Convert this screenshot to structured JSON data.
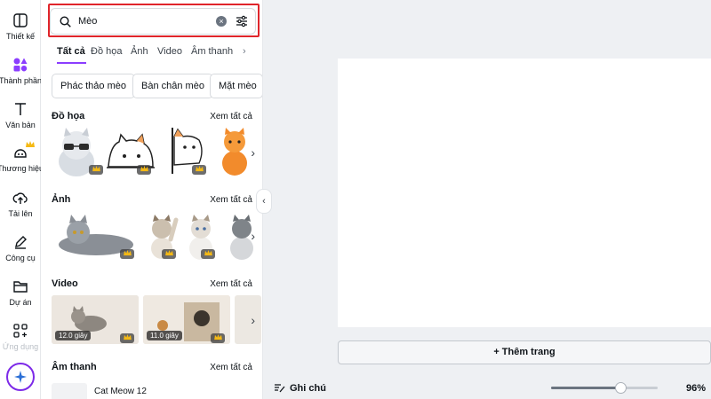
{
  "rail": [
    {
      "label": "Thiết kế",
      "icon": "layout-icon"
    },
    {
      "label": "Thành phần",
      "icon": "elements-icon",
      "active": true
    },
    {
      "label": "Văn bản",
      "icon": "text-icon"
    },
    {
      "label": "Thương hiệu",
      "icon": "brand-icon",
      "premium": true
    },
    {
      "label": "Tải lên",
      "icon": "upload-cloud-icon"
    },
    {
      "label": "Công cụ",
      "icon": "pen-icon"
    },
    {
      "label": "Dự án",
      "icon": "folder-icon"
    },
    {
      "label": "Ứng dụng",
      "icon": "apps-grid-icon"
    }
  ],
  "search": {
    "value": "Mèo"
  },
  "tabs": [
    "Tất cả",
    "Đồ họa",
    "Ảnh",
    "Video",
    "Âm thanh"
  ],
  "chips": [
    "Phác thảo mèo",
    "Bàn chân mèo",
    "Mặt mèo"
  ],
  "sections": {
    "graphics": {
      "title": "Đồ họa",
      "see_all": "Xem tất cả"
    },
    "photos": {
      "title": "Ảnh",
      "see_all": "Xem tất cả"
    },
    "videos": {
      "title": "Video",
      "see_all": "Xem tất cả",
      "durations": [
        "12.0 giây",
        "11.0 giây"
      ]
    },
    "audio": {
      "title": "Âm thanh",
      "see_all": "Xem tất cả",
      "first_track": "Cat Meow 12"
    }
  },
  "canvas": {
    "add_page": "+ Thêm trang"
  },
  "footer": {
    "notes": "Ghi chú",
    "zoom": "96%",
    "zoom_level": 0.65
  },
  "colors": {
    "accent": "#8b3dff",
    "highlight": "#e0252b"
  }
}
